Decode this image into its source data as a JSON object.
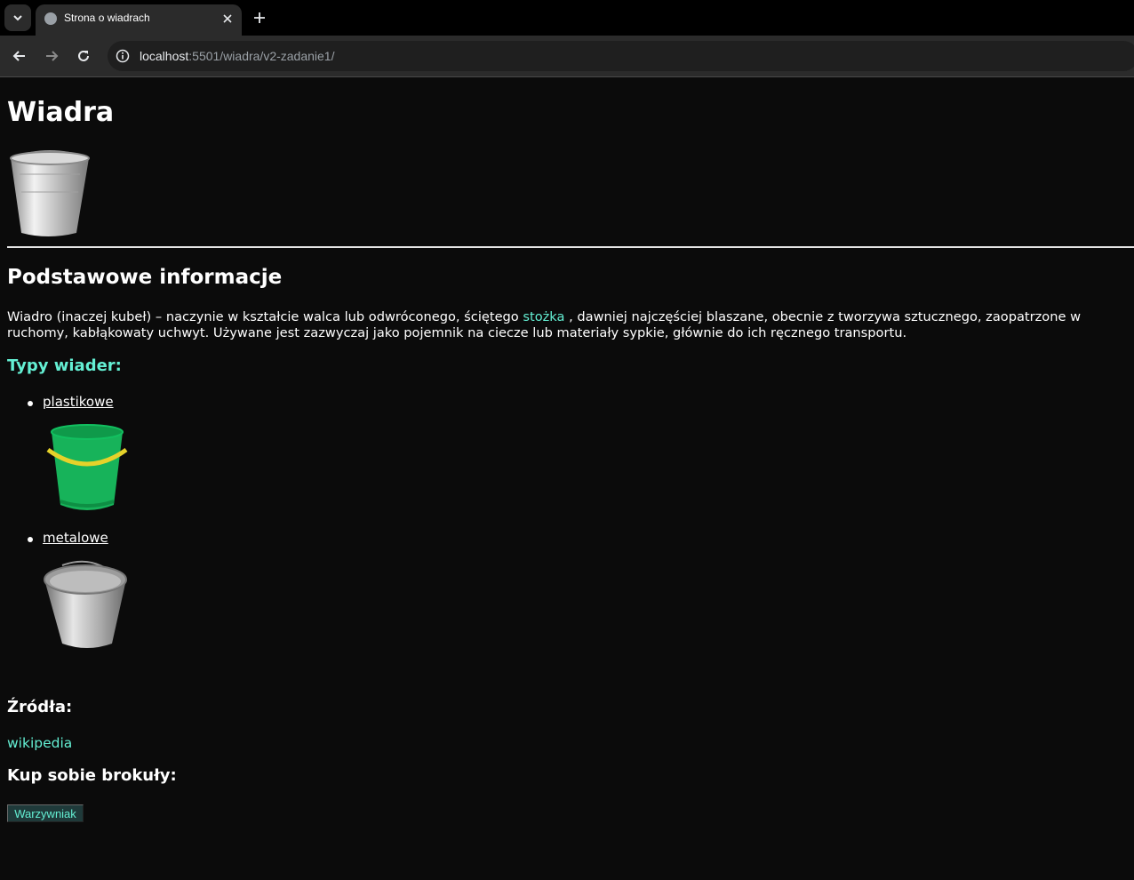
{
  "browser": {
    "tab_title": "Strona o wiadrach",
    "url_host": "localhost",
    "url_rest": ":5501/wiadra/v2-zadanie1/"
  },
  "page": {
    "title": "Wiadra",
    "section_title": "Podstawowe informacje",
    "intro_before": "Wiadro (inaczej kubeł) – naczynie w kształcie walca lub odwróconego, ściętego ",
    "intro_link": "stożka",
    "intro_after": " , dawniej najczęściej blaszane, obecnie z tworzywa sztucznego, zaopatrzone w ruchomy, kabłąkowaty uchwyt. Używane jest zazwyczaj jako pojemnik na ciecze lub materiały sypkie, głównie do ich ręcznego transportu.",
    "types_title": "Typy wiader:",
    "types": [
      {
        "label": "plastikowe",
        "icon": "plastic-bucket-image"
      },
      {
        "label": "metalowe",
        "icon": "metal-bucket-image"
      }
    ],
    "sources_title": "Źródła:",
    "sources_link": "wikipedia",
    "shop_title": "Kup sobie brokuły:",
    "shop_button": "Warzywniak"
  },
  "colors": {
    "background": "#0b0b0b",
    "accent": "#64f0d4",
    "text": "#ffffff"
  }
}
